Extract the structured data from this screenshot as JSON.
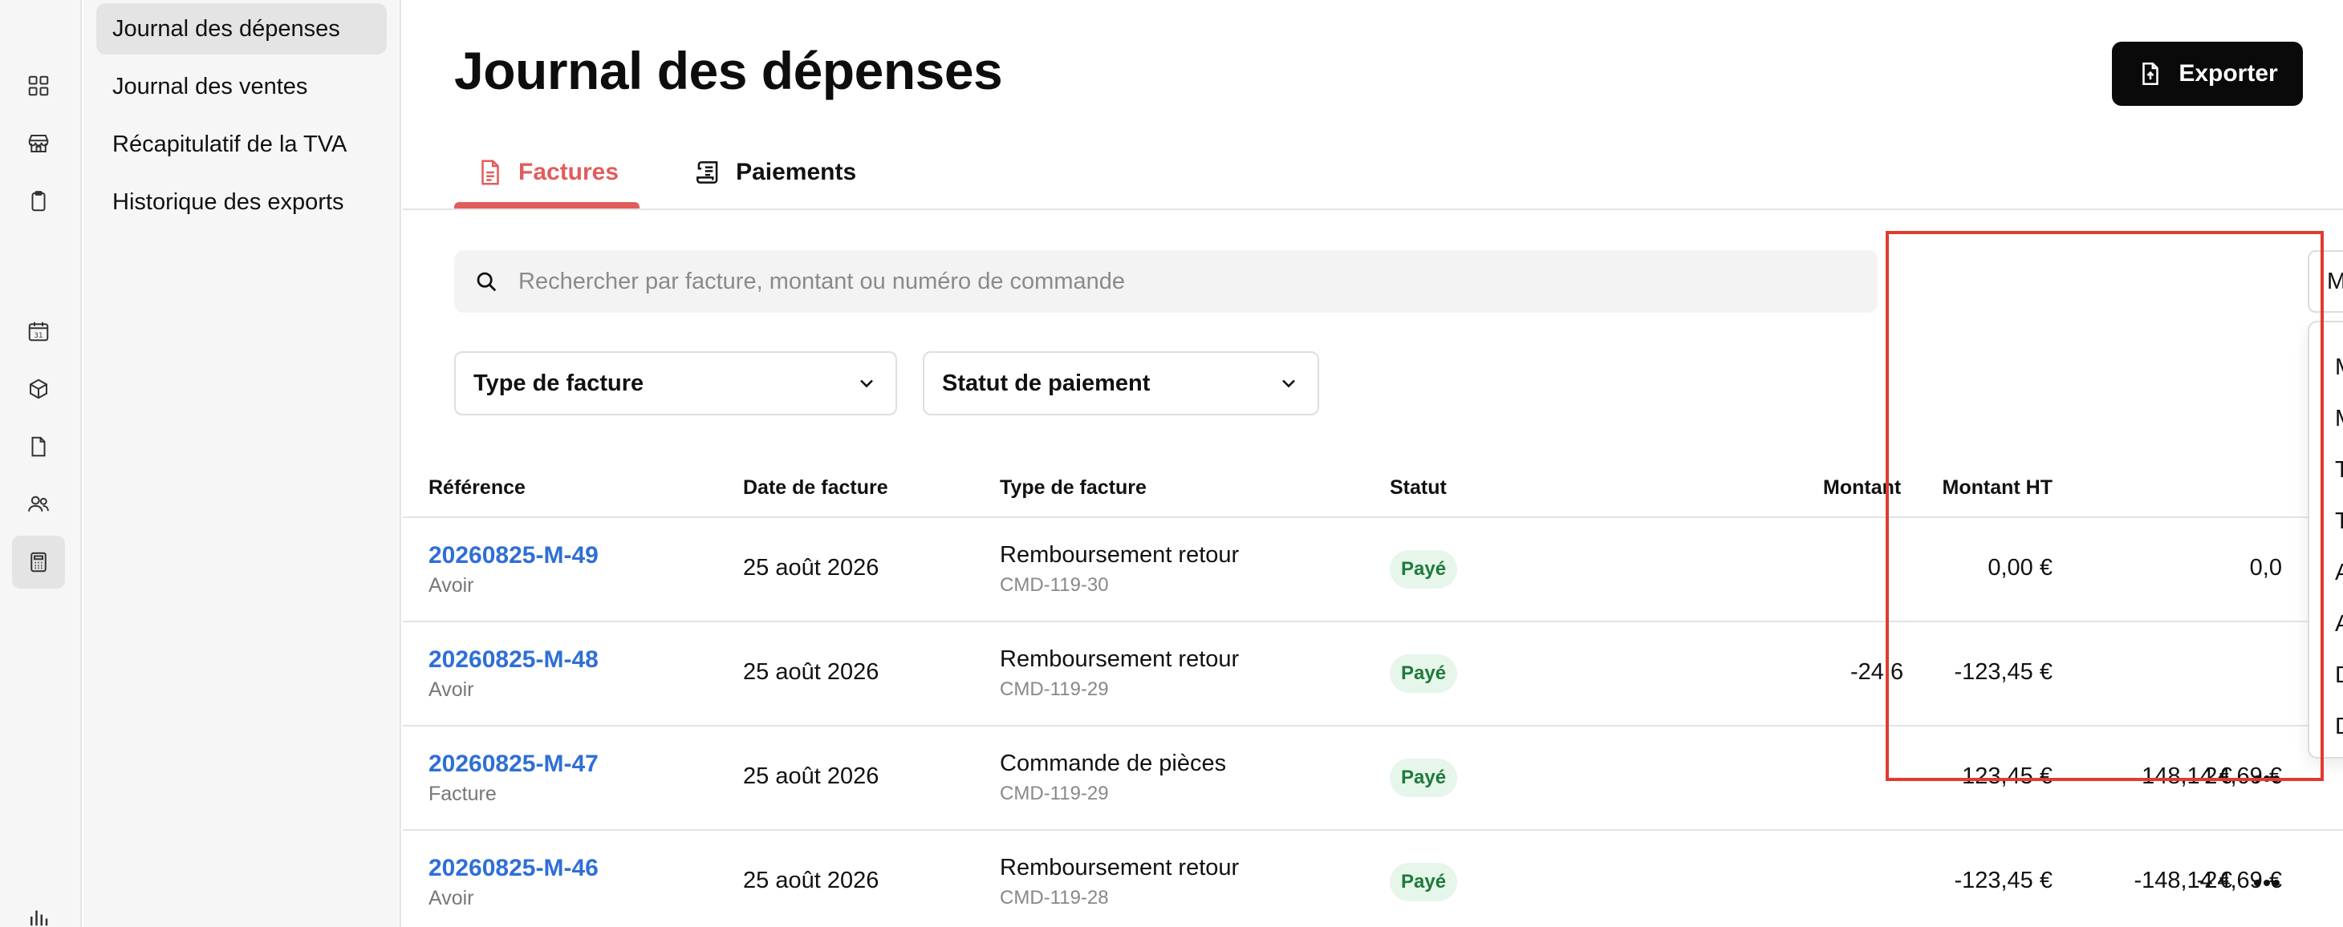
{
  "rail": {
    "icons": [
      {
        "name": "dashboard-grid-icon",
        "active": false
      },
      {
        "name": "store-icon",
        "active": false
      },
      {
        "name": "clipboard-icon",
        "active": false
      },
      {
        "name": "calendar-icon",
        "active": false,
        "label": "31"
      },
      {
        "name": "box-icon",
        "active": false
      },
      {
        "name": "document-icon",
        "active": false
      },
      {
        "name": "users-icon",
        "active": false
      },
      {
        "name": "calculator-icon",
        "active": true
      },
      {
        "name": "bar-chart-icon",
        "active": false
      }
    ]
  },
  "subnav": {
    "items": [
      {
        "label": "Journal des dépenses",
        "active": true
      },
      {
        "label": "Journal des ventes",
        "active": false
      },
      {
        "label": "Récapitulatif de la TVA",
        "active": false
      },
      {
        "label": "Historique des exports",
        "active": false
      }
    ]
  },
  "header": {
    "title": "Journal des dépenses",
    "export_label": "Exporter"
  },
  "tabs": [
    {
      "label": "Factures",
      "active": true
    },
    {
      "label": "Paiements",
      "active": false
    }
  ],
  "search": {
    "placeholder": "Rechercher par facture, montant ou numéro de commande",
    "value": ""
  },
  "filters": {
    "invoice_type": "Type de facture",
    "payment_status": "Statut de paiement",
    "period_selected": "Mois en cours"
  },
  "period_menu": {
    "options": [
      "Mois en cours",
      "Mois dernier",
      "Trimestre en cours",
      "Trimestre dernier",
      "Année en cours",
      "Année dernière",
      "Depuis le début",
      "Date personnalisée"
    ]
  },
  "table": {
    "columns": {
      "reference": "Référence",
      "date": "Date de facture",
      "type": "Type de facture",
      "status": "Statut",
      "amount_ht": "Montant HT",
      "amount_tva": "Montant"
    },
    "rows": [
      {
        "ref": "20260825-M-49",
        "ref_sub": "Avoir",
        "date": "25 août 2026",
        "type": "Remboursement retour",
        "order": "CMD-119-30",
        "status": "Payé",
        "amount_ht": "0,00 €",
        "amount_tva": "0,0",
        "amount_ttc": ""
      },
      {
        "ref": "20260825-M-48",
        "ref_sub": "Avoir",
        "date": "25 août 2026",
        "type": "Remboursement retour",
        "order": "CMD-119-29",
        "status": "Payé",
        "amount_ht": "-123,45 €",
        "amount_tva": "-24,6",
        "amount_ttc": ""
      },
      {
        "ref": "20260825-M-47",
        "ref_sub": "Facture",
        "date": "25 août 2026",
        "type": "Commande de pièces",
        "order": "CMD-119-29",
        "status": "Payé",
        "amount_ht": "123,45 €",
        "amount_tva": "24,69 €",
        "amount_ttc": "148,14 €"
      },
      {
        "ref": "20260825-M-46",
        "ref_sub": "Avoir",
        "date": "25 août 2026",
        "type": "Remboursement retour",
        "order": "CMD-119-28",
        "status": "Payé",
        "amount_ht": "-123,45 €",
        "amount_tva": "-24,69 €",
        "amount_ttc": "-148,14 €"
      }
    ]
  },
  "colors": {
    "accent": "#e25c5c",
    "link": "#2f6fd6",
    "paid_bg": "#e6f6ea",
    "paid_text": "#1e7a3a",
    "highlight": "#e03b2f"
  }
}
